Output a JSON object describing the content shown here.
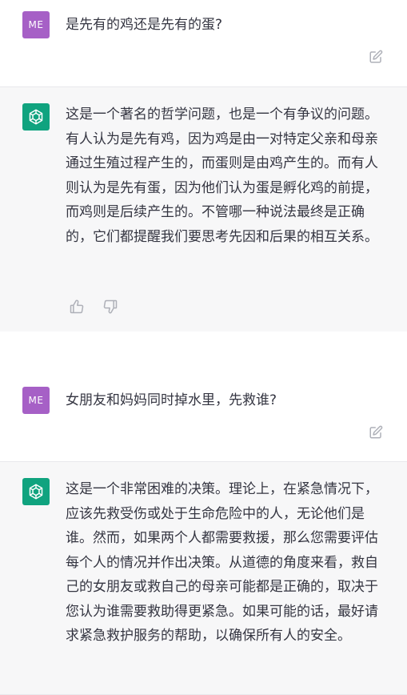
{
  "conversation": [
    {
      "role": "user",
      "avatar": "ME",
      "text": "是先有的鸡还是先有的蛋?"
    },
    {
      "role": "assistant",
      "text": "这是一个著名的哲学问题，也是一个有争议的问题。有人认为是先有鸡，因为鸡是由一对特定父亲和母亲通过生殖过程产生的，而蛋则是由鸡产生的。而有人则认为是先有蛋，因为他们认为蛋是孵化鸡的前提，而鸡则是后续产生的。不管哪一种说法最终是正确的，它们都提醒我们要思考先因和后果的相互关系。"
    },
    {
      "role": "user",
      "avatar": "ME",
      "text": "女朋友和妈妈同时掉水里，先救谁?"
    },
    {
      "role": "assistant",
      "text": "这是一个非常困难的决策。理论上，在紧急情况下，应该先救受伤或处于生命危险中的人，无论他们是谁。然而，如果两个人都需要救援，那么您需要评估每个人的情况并作出决策。从道德的角度来看，救自己的女朋友或救自己的母亲可能都是正确的，取决于您认为谁需要救助得更紧急。如果可能的话，最好请求紧急救护服务的帮助，以确保所有人的安全。"
    }
  ],
  "icons": {
    "assistant_avatar": "openai-logo-icon",
    "edit": "edit-icon",
    "like": "thumbs-up-icon",
    "dislike": "thumbs-down-icon"
  },
  "colors": {
    "user_avatar": "#a660c6",
    "assistant_avatar": "#10a37f",
    "assistant_bg": "#f7f7f8",
    "text": "#343541",
    "icon": "#aeb0b8"
  }
}
